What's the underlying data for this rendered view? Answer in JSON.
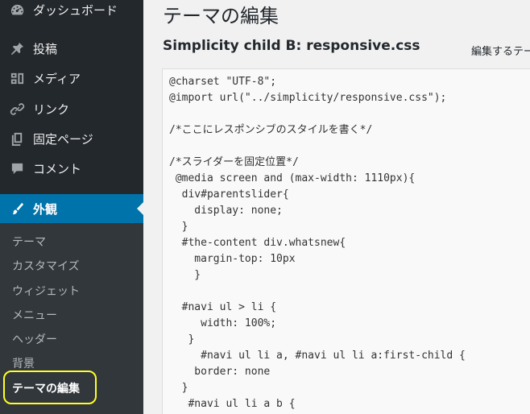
{
  "sidebar": {
    "items": [
      {
        "label": "ダッシュボード",
        "icon": "dashboard-icon"
      },
      {
        "label": "投稿",
        "icon": "pin-icon"
      },
      {
        "label": "メディア",
        "icon": "media-icon"
      },
      {
        "label": "リンク",
        "icon": "link-icon"
      },
      {
        "label": "固定ページ",
        "icon": "pages-icon"
      },
      {
        "label": "コメント",
        "icon": "comment-icon"
      }
    ],
    "active": {
      "label": "外観",
      "icon": "appearance-brush-icon"
    },
    "submenu": [
      "テーマ",
      "カスタマイズ",
      "ウィジェット",
      "メニュー",
      "ヘッダー",
      "背景",
      "テーマの編集"
    ],
    "current_submenu": "テーマの編集"
  },
  "main": {
    "title": "テーマの編集",
    "file_title": "Simplicity child B: responsive.css",
    "file_select_label": "編集するテーマを選択"
  },
  "editor": {
    "lines": [
      "@charset \"UTF-8\";",
      "@import url(\"../simplicity/responsive.css\");",
      "",
      "/*ここにレスポンシブのスタイルを書く*/",
      "",
      "/*スライダーを固定位置*/",
      " @media screen and (max-width: 1110px){",
      "  div#parentslider{",
      "    display: none;",
      "  }",
      "  #the-content div.whatsnew{",
      "    margin-top: 10px",
      "    }",
      "",
      "  #navi ul > li {",
      "     width: 100%;",
      "   }",
      "     #navi ul li a, #navi ul li a:first-child {",
      "    border: none",
      "  }",
      "   #navi ul li a b {"
    ]
  },
  "colors": {
    "sidebar_bg": "#23282d",
    "submenu_bg": "#32373c",
    "active_bg": "#0073aa",
    "highlight": "#ffff22"
  }
}
